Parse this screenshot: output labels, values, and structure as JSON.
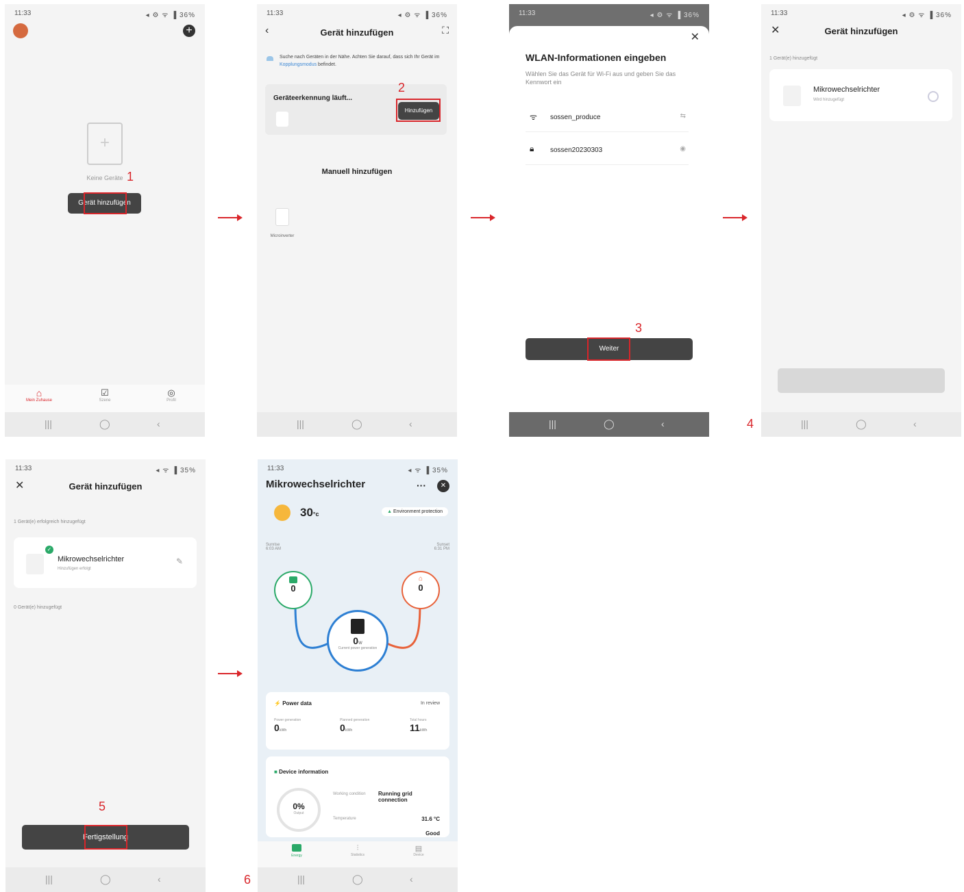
{
  "common": {
    "status_time": "11:33",
    "status_right": "◂ ⚙ ᯤ ▐ 36%",
    "status_right_2": "◂ ᯤ ▐ 35%",
    "nav_recent": "|||",
    "nav_home": "◯",
    "nav_back": "‹"
  },
  "steps": {
    "s1": "1",
    "s2": "2",
    "s3": "3",
    "s4": "4",
    "s5": "5",
    "s6": "6"
  },
  "screen1": {
    "empty_text": "Keine Geräte",
    "add_button": "Gerät hinzufügen",
    "tab_home": "Mein Zuhause",
    "tab_scene": "Szene",
    "tab_profile": "Profil"
  },
  "screen2": {
    "title": "Gerät hinzufügen",
    "hint_pre": "Suche nach Geräten in der Nähe. Achten Sie darauf, dass sich Ihr Gerät im",
    "hint_link": "Kopplungsmodus",
    "hint_post": "befindet.",
    "scanning": "Geräteerkennung läuft...",
    "add_button": "Hinzufügen",
    "manual_title": "Manuell hinzufügen",
    "device_label": "Microinverter"
  },
  "screen3": {
    "title": "WLAN-Informationen eingeben",
    "subtitle": "Wählen Sie das Gerät für Wi-Fi aus und geben Sie das Kennwort ein",
    "ssid": "sossen_produce",
    "password": "sossen20230303",
    "next_button": "Weiter"
  },
  "screen4": {
    "title": "Gerät hinzufügen",
    "count_text": "1 Gerät(e) hinzugefügt",
    "device_name": "Mikrowechselrichter",
    "device_status": "Wird hinzugefügt"
  },
  "screen5": {
    "title": "Gerät hinzufügen",
    "success_count": "1 Gerät(e) erfolgreich hinzugefügt",
    "device_name": "Mikrowechselrichter",
    "device_status": "Hinzufügen erfolgt",
    "pending_count": "0 Gerät(e) hinzugefügt",
    "done_button": "Fertigstellung"
  },
  "screen6": {
    "title": "Mikrowechselrichter",
    "more": "···",
    "temperature": "30",
    "temp_unit": "°c",
    "env_badge": "Environment protection",
    "sunrise_label": "Sunrise",
    "sunrise_time": "6:03 AM",
    "sunset_label": "Sunset",
    "sunset_time": "6:31 PM",
    "left_value": "0",
    "right_value": "0",
    "center_value": "0",
    "center_unit": "W",
    "center_label": "Current power generation",
    "power_title": "Power data",
    "power_link": "In review",
    "p1_label": "Power generation",
    "p1_value": "0",
    "p1_unit": "kWh",
    "p2_label": "Planned generation",
    "p2_value": "0",
    "p2_unit": "kWh",
    "p3_label": "Total hours",
    "p3_value": "11",
    "p3_unit": "kWh",
    "device_title": "Device information",
    "gauge_value": "0%",
    "gauge_label": "Output",
    "work_label": "Working condition",
    "work_value": "Running grid connection",
    "temp_label": "Temperature",
    "temp_value": "31.6 °C",
    "third_value": "Good",
    "tab1": "Energy",
    "tab2": "Statistics",
    "tab3": "Device"
  },
  "colors": {
    "accent": "#d9252a",
    "dark_button": "#444444",
    "green": "#2aa968",
    "blue": "#2d7fd3",
    "orange": "#e8623a"
  }
}
